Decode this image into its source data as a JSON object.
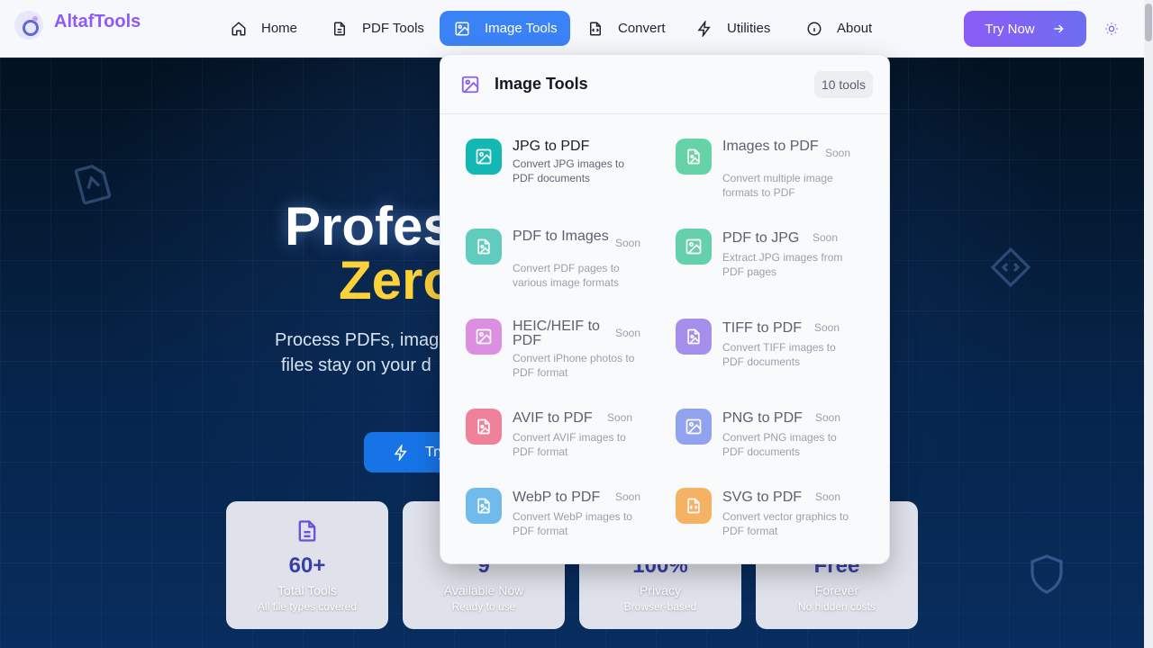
{
  "header": {
    "logo_text": "AltafTools",
    "nav": [
      {
        "label": "Home",
        "icon": "home-icon"
      },
      {
        "label": "PDF Tools",
        "icon": "file-text-icon"
      },
      {
        "label": "Image Tools",
        "icon": "image-icon",
        "active": true
      },
      {
        "label": "Convert",
        "icon": "file-code-icon"
      },
      {
        "label": "Utilities",
        "icon": "zap-icon"
      },
      {
        "label": "About",
        "icon": "info-icon"
      }
    ],
    "cta_label": "Try Now",
    "accent": "#3b82f6",
    "brand": "#8b5cf6"
  },
  "hero": {
    "title_line1": "Profes",
    "title_line2": "Zero",
    "subtitle_line1": "Process PDFs, imag",
    "subtitle_line2": "files stay on your d",
    "button_label": "Try",
    "stats": [
      {
        "value": "60+",
        "label": "Total Tools",
        "sub": "All file types covered"
      },
      {
        "value": "9",
        "label": "Available Now",
        "sub": "Ready to use"
      },
      {
        "value": "100%",
        "label": "Privacy",
        "sub": "Browser-based"
      },
      {
        "value": "Free",
        "label": "Forever",
        "sub": "No hidden costs"
      }
    ]
  },
  "dropdown": {
    "title": "Image Tools",
    "count": "10 tools",
    "tools": [
      {
        "name": "JPG to PDF",
        "desc": "Convert JPG images to PDF documents",
        "soon": "",
        "color": "#14b8b3",
        "icon": "image-icon"
      },
      {
        "name": "Images to PDF",
        "desc": "Convert multiple image formats to PDF",
        "soon": "Soon",
        "color": "#34c78a",
        "icon": "file-image-icon"
      },
      {
        "name": "PDF to Images",
        "desc": "Convert PDF pages to various image formats",
        "soon": "Soon",
        "color": "#2dbdaa",
        "icon": "file-image-icon"
      },
      {
        "name": "PDF to JPG",
        "desc": "Extract JPG images from PDF pages",
        "soon": "Soon",
        "color": "#36c394",
        "icon": "image-icon"
      },
      {
        "name": "HEIC/HEIF to PDF",
        "desc": "Convert iPhone photos to PDF format",
        "soon": "Soon",
        "color": "#d36bd9",
        "icon": "image-icon"
      },
      {
        "name": "TIFF to PDF",
        "desc": "Convert TIFF images to PDF documents",
        "soon": "Soon",
        "color": "#8b6be8",
        "icon": "file-image-icon"
      },
      {
        "name": "AVIF to PDF",
        "desc": "Convert AVIF images to PDF format",
        "soon": "Soon",
        "color": "#ec5a7a",
        "icon": "file-image-icon"
      },
      {
        "name": "PNG to PDF",
        "desc": "Convert PNG images to PDF documents",
        "soon": "Soon",
        "color": "#6f86ea",
        "icon": "image-icon"
      },
      {
        "name": "WebP to PDF",
        "desc": "Convert WebP images to PDF format",
        "soon": "Soon",
        "color": "#43a6e6",
        "icon": "file-image-icon"
      },
      {
        "name": "SVG to PDF",
        "desc": "Convert vector graphics to PDF format",
        "soon": "Soon",
        "color": "#f49a34",
        "icon": "file-code-icon"
      }
    ]
  }
}
